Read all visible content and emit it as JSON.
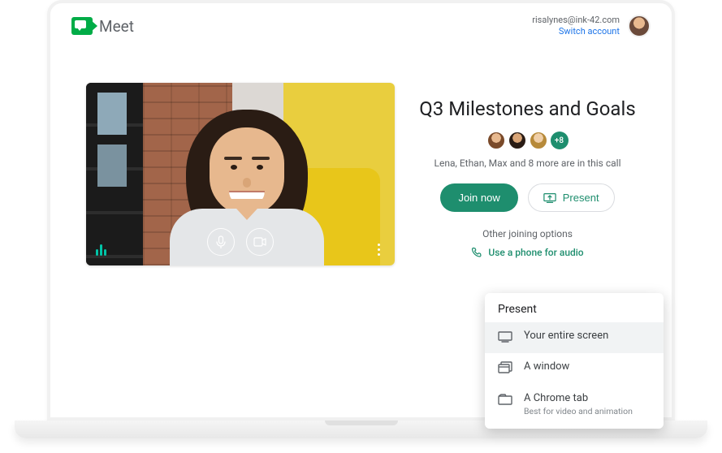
{
  "brand": {
    "name": "Meet"
  },
  "account": {
    "email": "risalynes@ink-42.com",
    "switch_label": "Switch account"
  },
  "meeting": {
    "title": "Q3 Milestones and Goals",
    "more_count": "+8",
    "participants_text": "Lena, Ethan, Max and 8 more are in this call",
    "join_label": "Join now",
    "present_label": "Present",
    "other_options_label": "Other joining options",
    "phone_link_label": "Use a phone for audio"
  },
  "popup": {
    "title": "Present",
    "items": [
      {
        "label": "Your entire screen",
        "hint": ""
      },
      {
        "label": "A window",
        "hint": ""
      },
      {
        "label": "A Chrome tab",
        "hint": "Best for video and animation"
      }
    ]
  },
  "colors": {
    "accent": "#1e8e6e",
    "link": "#1a73e8"
  }
}
